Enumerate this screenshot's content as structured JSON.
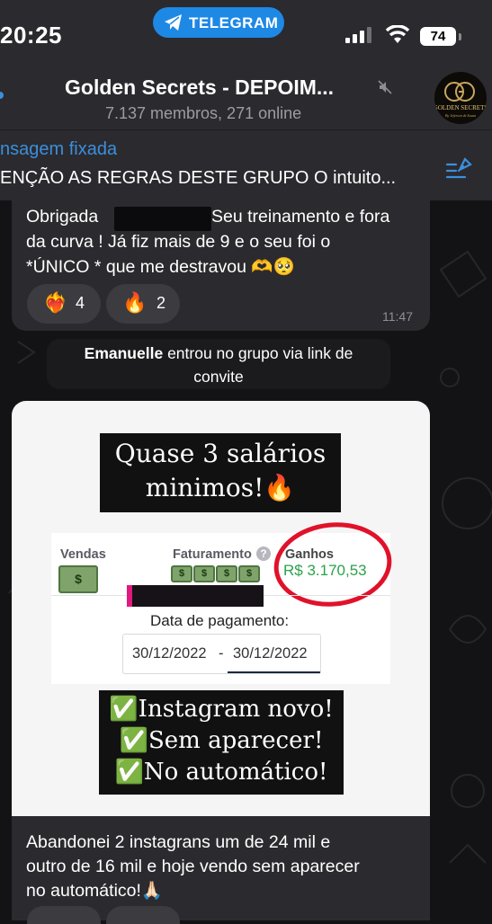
{
  "status_bar": {
    "time": "20:25",
    "app_pill": "TELEGRAM",
    "battery": "74",
    "icons": [
      "telegram-plane-icon",
      "signal-icon",
      "wifi-icon",
      "battery-icon"
    ]
  },
  "header": {
    "title": "Golden Secrets - DEPOIM...",
    "subtitle": "7.137 membros, 271 online",
    "avatar_text": "GOLDEN SECRETS",
    "avatar_script": "By Jeferson de Souza",
    "icons": [
      "mute-icon"
    ]
  },
  "pinned": {
    "label": "nsagem fixada",
    "text": "ENÇÃO AS REGRAS DESTE GRUPO O intuito...",
    "icon": "pin-list-icon"
  },
  "message1": {
    "line1_a": "Obrigada",
    "line1_b": "Seu treinamento e fora",
    "line2": "da curva ! Já fiz mais de 9 e o seu foi o",
    "line3": "*ÚNICO * que me destravou 🫶🥺",
    "time": "11:47",
    "reactions": [
      {
        "emoji": "❤️‍🔥",
        "count": "4"
      },
      {
        "emoji": "🔥",
        "count": "2"
      }
    ]
  },
  "service_message": {
    "name": "Emanuelle",
    "text": " entrou no grupo via link de",
    "text2": "convite"
  },
  "image": {
    "banner_top_line1": "Quase 3 salários",
    "banner_top_line2": "minimos!🔥",
    "dashboard": {
      "col_vendas": "Vendas",
      "col_faturamento": "Faturamento",
      "col_ganhos": "Ganhos",
      "help": "?",
      "money_symbol": "$",
      "ganhos_value": "R$ 3.170,53",
      "payment_label": "Data de pagamento:",
      "date_from": "30/12/2022",
      "date_sep": "-",
      "date_to": "30/12/2022"
    },
    "banner_bottom_line1": "✅Instagram novo!",
    "banner_bottom_line2": "✅Sem aparecer!",
    "banner_bottom_line3": "✅No automático!"
  },
  "message2": {
    "line1": "Abandonei 2 instagrans um de 24 mil e",
    "line2": "outro de 16 mil e hoje vendo sem aparecer",
    "line3": "no automático!🙏🏻"
  },
  "colors": {
    "accent": "#3b8fdd",
    "bubble": "#2b2a2e",
    "green_value": "#2aa24a",
    "ring_red": "#e0122a"
  }
}
